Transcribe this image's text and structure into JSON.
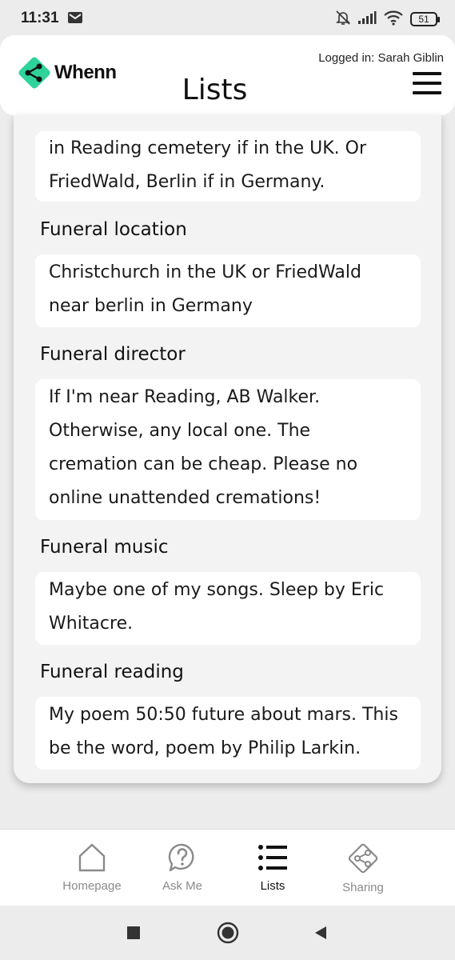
{
  "status_bar": {
    "time": "11:31",
    "battery": "51",
    "icons": [
      "mail-icon",
      "bell-off-icon",
      "signal-icon",
      "wifi-icon",
      "battery-icon"
    ]
  },
  "header": {
    "brand": "Whenn",
    "title": "Lists",
    "logged_in": "Logged in: Sarah Giblin",
    "brand_color": "#2ed39a"
  },
  "sections": [
    {
      "answer_lines": [
        "in Reading cemetery if in the UK. Or",
        "FriedWald, Berlin if in Germany."
      ]
    },
    {
      "label": "Funeral location",
      "answer_lines": [
        "Christchurch in the UK or FriedWald",
        "near berlin in Germany"
      ]
    },
    {
      "label": "Funeral director",
      "answer_lines": [
        "If I'm near Reading, AB Walker.",
        "Otherwise, any local one. The",
        "cremation can be cheap. Please no",
        "online unattended cremations!"
      ]
    },
    {
      "label": "Funeral music",
      "answer_lines": [
        "Maybe one of my songs. Sleep by Eric",
        "Whitacre."
      ]
    },
    {
      "label": "Funeral reading",
      "answer_lines": [
        "My poem 50:50 future about mars. This",
        "be the word, poem by Philip Larkin."
      ]
    }
  ],
  "bottom_nav": {
    "items": [
      {
        "label": "Homepage",
        "icon": "home-icon"
      },
      {
        "label": "Ask Me",
        "icon": "question-bubble-icon"
      },
      {
        "label": "Lists",
        "icon": "list-icon",
        "active": true
      },
      {
        "label": "Sharing",
        "icon": "share-icon"
      }
    ]
  },
  "system_nav": [
    "recents-square-icon",
    "home-circle-icon",
    "back-triangle-icon"
  ]
}
